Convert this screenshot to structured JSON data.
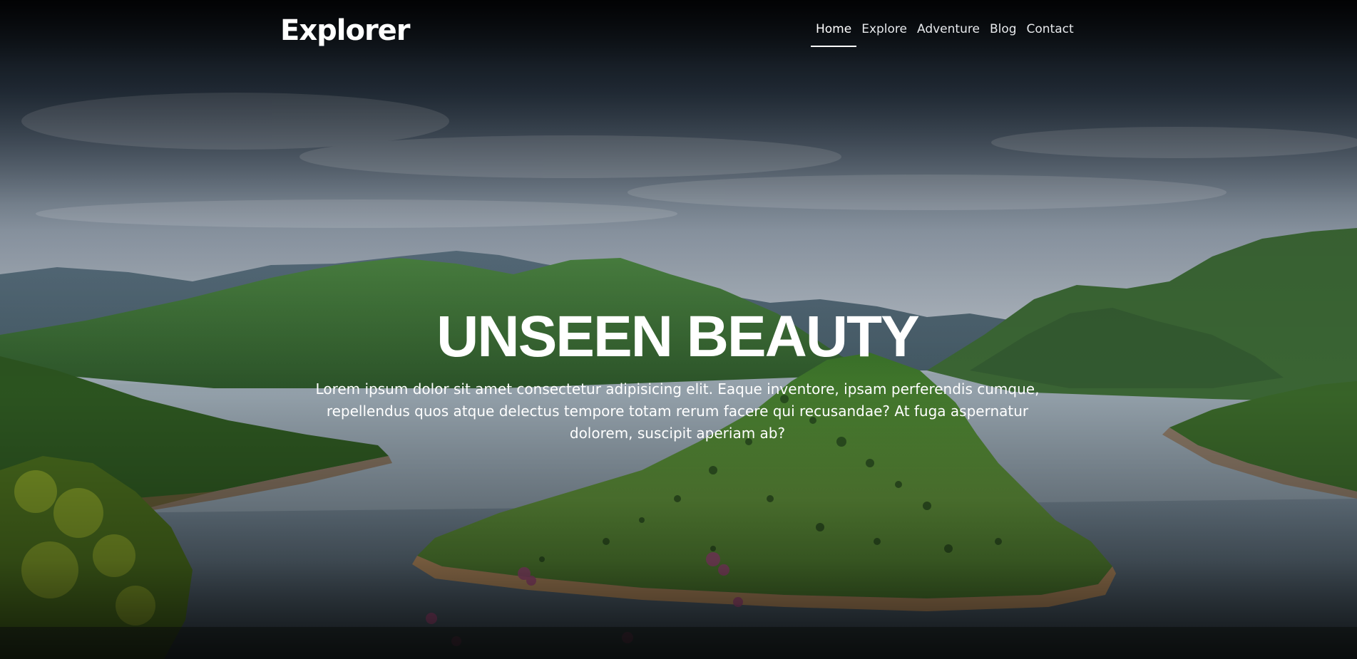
{
  "brand": {
    "title": "Explorer"
  },
  "nav": {
    "items": [
      {
        "label": "Home",
        "active": true
      },
      {
        "label": "Explore",
        "active": false
      },
      {
        "label": "Adventure",
        "active": false
      },
      {
        "label": "Blog",
        "active": false
      },
      {
        "label": "Contact",
        "active": false
      }
    ]
  },
  "hero": {
    "title": "UNSEEN BEAUTY",
    "text": "Lorem ipsum dolor sit amet consectetur adipisicing elit. Eaque inventore, ipsam perferendis cumque, repellendus quos atque delectus tempore totam rerum facere qui recusandae? At fuga aspernatur dolorem, suscipit aperiam ab?"
  },
  "colors": {
    "text": "#ffffff",
    "sky": "#5a6f86",
    "mountain": "#4a7a3c",
    "water": "#7b8c99"
  }
}
